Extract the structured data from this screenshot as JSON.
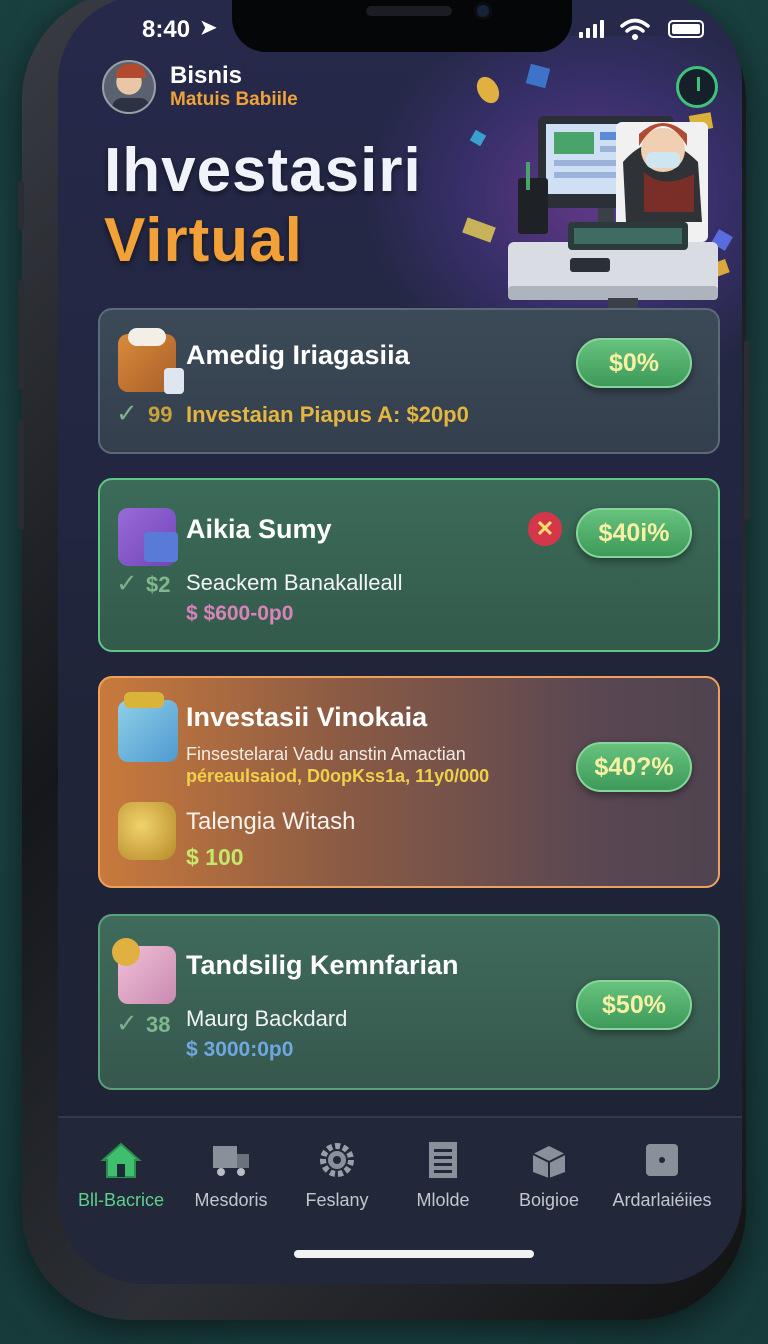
{
  "status_bar": {
    "time": "8:40"
  },
  "profile": {
    "name": "Bisnis",
    "subtitle": "Matuis Babiile"
  },
  "hero": {
    "title_line1": "Ihvestasiri",
    "title_line2": "Virtual"
  },
  "cards": [
    {
      "title": "Amedig Iriagasiia",
      "check_number": "99",
      "detail": "Investaian Piapus A: $20p0",
      "percent": "$0%"
    },
    {
      "title": "Aikia Sumy",
      "check_number": "$2",
      "detail": "Seackem Banakalleall",
      "amount": "$ $600-0p0",
      "percent": "$40i%"
    },
    {
      "title": "Investasii Vinokaia",
      "desc_line1": "Finsestelarai Vadu anstin Amactian",
      "desc_line2": "péreaulsaiod, D0opKss1a, 11y0/000",
      "sub_title": "Talengia Witash",
      "amount": "$ 100",
      "percent": "$40?%"
    },
    {
      "title": "Tandsilig Kemnfarian",
      "check_number": "38",
      "detail": "Maurg Backdard",
      "amount": "$ 3000:0p0",
      "percent": "$50%"
    }
  ],
  "nav": [
    {
      "label": "Bll-Bacrice",
      "icon": "home-icon",
      "active": true
    },
    {
      "label": "Mesdoris",
      "icon": "truck-icon"
    },
    {
      "label": "Feslany",
      "icon": "gear-icon"
    },
    {
      "label": "Mlolde",
      "icon": "document-icon"
    },
    {
      "label": "Boigioe",
      "icon": "box-icon"
    },
    {
      "label": "Ardarlaiéiies",
      "icon": "info-icon"
    }
  ],
  "colors": {
    "accent_green": "#5fd08a",
    "accent_orange": "#f1a137",
    "pill_text": "#f8f1a4"
  }
}
